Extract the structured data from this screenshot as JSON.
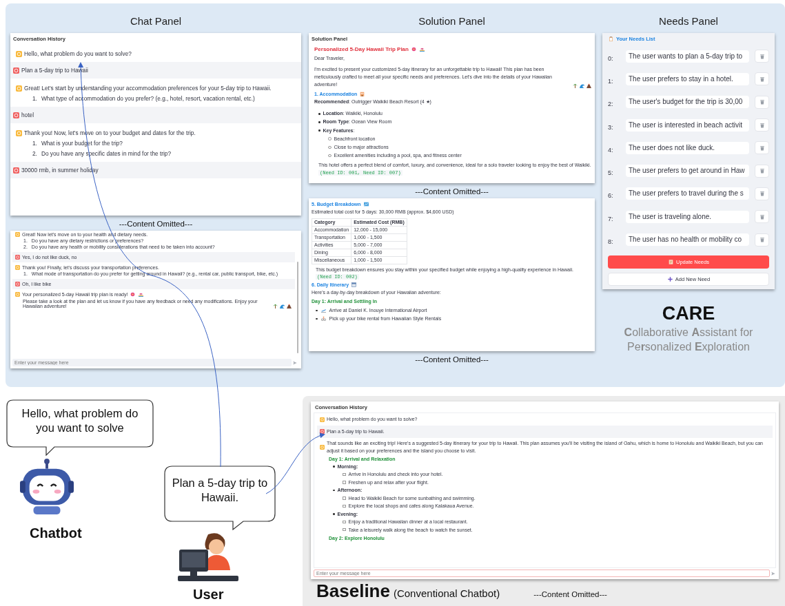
{
  "care_panel": {
    "chat_panel": {
      "title": "Chat Panel",
      "header": "Conversation History",
      "messages": [
        {
          "kind": "bot",
          "text": "Hello, what problem do you want to solve?"
        },
        {
          "kind": "user",
          "text": "Plan a 5-day trip to Hawaii"
        },
        {
          "kind": "bot",
          "text": "Great! Let's start by understanding your accommodation preferences for your 5-day trip to Hawaii.",
          "items": [
            {
              "number": "1.",
              "text": "What type of accommodation do you prefer? (e.g., hotel, resort, vacation rental, etc.)"
            }
          ]
        },
        {
          "kind": "user",
          "text": "hotel"
        },
        {
          "kind": "bot",
          "text": "Thank you! Now, let's move on to your budget and dates for the trip.",
          "items": [
            {
              "number": "1.",
              "text": "What is your budget for the trip?"
            },
            {
              "number": "2.",
              "text": "Do you have any specific dates in mind for the trip?"
            }
          ]
        },
        {
          "kind": "user",
          "text": "30000 rmb, in summer holiday"
        }
      ],
      "omitted": "---Content Omitted---",
      "messages_continued": [
        {
          "kind": "bot",
          "text": "Great! Now let's move on to your health and dietary needs.",
          "items": [
            {
              "number": "1.",
              "text": "Do you have any dietary restrictions or preferences?"
            },
            {
              "number": "2.",
              "text": "Do you have any health or mobility considerations that need to be taken into account?"
            }
          ]
        },
        {
          "kind": "user",
          "text": "Yes, I do not like duck, no"
        },
        {
          "kind": "bot",
          "text": "Thank you! Finally, let's discuss your transportation preferences.",
          "items": [
            {
              "number": "1.",
              "text": "What mode of transportation do you prefer for getting around in Hawaii? (e.g., rental car, public transport, bike, etc.)"
            }
          ]
        },
        {
          "kind": "user",
          "text": "Oh, I like bike"
        },
        {
          "kind": "bot",
          "text": "Your personalized 5-day Hawaii trip plan is ready!",
          "extra": "Please take a look at the plan and let us know if you have any feedback or need any modifications. Enjoy your Hawaiian adventure!"
        }
      ],
      "input_placeholder": "Enter your message here"
    },
    "solution_panel": {
      "title": "Solution Panel",
      "header": "Solution Panel",
      "plan_title": "Personalized 5-Day Hawaii Trip Plan",
      "greeting": "Dear Traveler,",
      "intro": "I'm excited to present your customized 5-day itinerary for an unforgettable trip to Hawaii! This plan has been meticulously crafted to meet all your specific needs and preferences. Let's dive into the details of your Hawaiian adventure!",
      "accommodation_heading": "1. Accommodation",
      "recommended": "**Recommended**: Outrigger Waikiki Beach Resort (4 ★)",
      "bullets": [
        {
          "text": "**Location**: Waikiki, Honolulu"
        },
        {
          "text": "**Room Type**: Ocean View Room"
        },
        {
          "text": "**Key Features**:",
          "children": [
            "Beachfront location",
            "Close to major attractions",
            "Excellent amenities including a pool, spa, and fitness center"
          ]
        }
      ],
      "accommodation_note": "This hotel offers a perfect blend of comfort, luxury, and convenience, ideal for a solo traveler looking to enjoy the best of Waikiki.",
      "accommodation_tag": "(Need ID: 001, Need ID: 007)",
      "omitted": "---Content Omitted---",
      "budget_heading": "5. Budget Breakdown",
      "budget_total": "Estimated total cost for 5 days: 30,000 RMB (approx. $4,600 USD)",
      "budget_table": {
        "columns": [
          "Category",
          "Estimated Cost (RMB)"
        ],
        "rows": [
          [
            "Accommodation",
            "12,000 - 15,000"
          ],
          [
            "Transportation",
            "1,000 - 1,500"
          ],
          [
            "Activities",
            "5,000 - 7,000"
          ],
          [
            "Dining",
            "6,000 - 8,000"
          ],
          [
            "Miscellaneous",
            "1,000 - 1,500"
          ]
        ]
      },
      "budget_note": "This budget breakdown ensures you stay within your specified budget while enjoying a high-quality experience in Hawaii.",
      "budget_tag": "(Need ID: 002)",
      "itinerary_heading": "6. Daily Itinerary",
      "itinerary_intro": "Here's a day-by-day breakdown of your Hawaiian adventure:",
      "day_heading": "Day 1: Arrival and Settling In",
      "day_items": [
        "Arrive at Daniel K. Inouye International Airport",
        "Pick up your bike rental from Hawaiian Style Rentals"
      ],
      "omitted_2": "---Content Omitted---"
    },
    "needs_panel": {
      "title": "Needs Panel",
      "header": "Your Needs List",
      "needs": [
        {
          "index": "0:",
          "value": "The user wants to plan a 5-day trip to"
        },
        {
          "index": "1:",
          "value": "The user prefers to stay in a hotel."
        },
        {
          "index": "2:",
          "value": "The user's budget for the trip is 30,00"
        },
        {
          "index": "3:",
          "value": "The user is interested in beach activit"
        },
        {
          "index": "4:",
          "value": "The user does not like duck."
        },
        {
          "index": "5:",
          "value": "The user prefers to get around in Haw"
        },
        {
          "index": "6:",
          "value": "The user prefers to travel during the s"
        },
        {
          "index": "7:",
          "value": "The user is traveling alone."
        },
        {
          "index": "8:",
          "value": "The user has no health or mobility co"
        }
      ],
      "update_button": "Update Needs",
      "add_button": "Add New Need"
    },
    "name": "CARE",
    "subtitle": "**C**ollaborative **A**ssistant for Pe**r**sonalized **E**xploration"
  },
  "actors": {
    "chatbot_bubble": "Hello, what problem do you want to solve",
    "chatbot_label": "Chatbot",
    "user_bubble": "Plan a 5-day trip to Hawaii.",
    "user_label": "User"
  },
  "baseline": {
    "header": "Conversation History",
    "messages": [
      {
        "kind": "bot",
        "text": "Hello, what problem do you want to solve?"
      },
      {
        "kind": "user",
        "text": "Plan a 5-day trip to Hawaii."
      },
      {
        "kind": "bot",
        "text": "That sounds like an exciting trip! Here's a suggested 5-day itinerary for your trip to Hawaii. This plan assumes you'll be visiting the island of Oahu, which is home to Honolulu and Waikiki Beach, but you can adjust it based on your preferences and the island you choose to visit.",
        "sections": [
          {
            "heading": "Day 1: Arrival and Relaxation",
            "bullets": [
              {
                "label": "Morning:",
                "items": [
                  "Arrive in Honolulu and check into your hotel.",
                  "Freshen up and relax after your flight."
                ]
              },
              {
                "label": "Afternoon:",
                "items": [
                  "Head to Waikiki Beach for some sunbathing and swimming.",
                  "Explore the local shops and cafes along Kalakaua Avenue."
                ]
              },
              {
                "label": "Evening:",
                "items": [
                  "Enjoy a traditional Hawaiian dinner at a local restaurant.",
                  "Take a leisurely walk along the beach to watch the sunset."
                ]
              }
            ]
          },
          {
            "heading": "Day 2: Explore Honolulu"
          }
        ]
      }
    ],
    "input_placeholder": "Enter your message here",
    "title": "Baseline",
    "subtitle": "(Conventional Chatbot)",
    "omitted": "---Content Omitted---"
  }
}
